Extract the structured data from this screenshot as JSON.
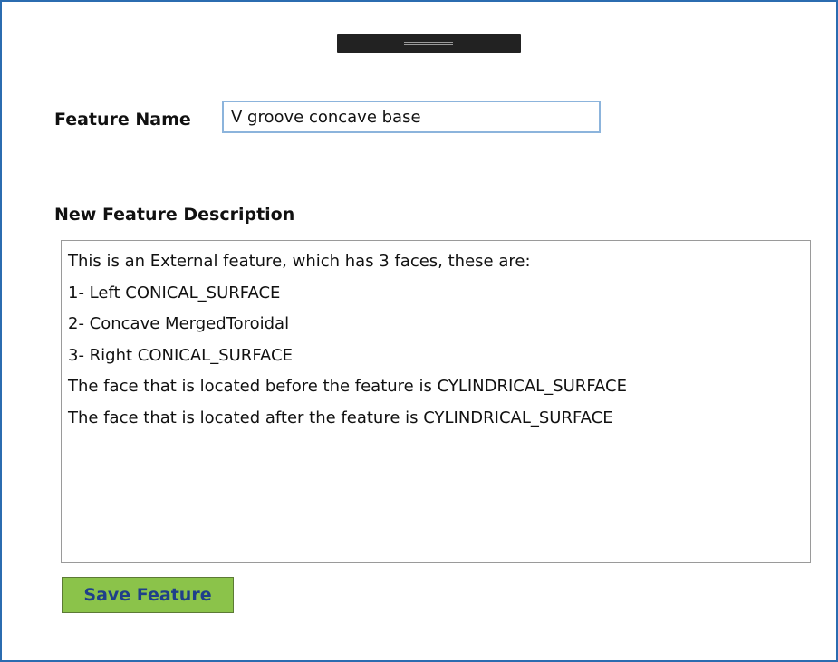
{
  "form": {
    "feature_name_label": "Feature Name",
    "feature_name_value": "V groove concave base",
    "description_label": "New Feature Description",
    "description_lines": [
      "This is an External feature, which has 3 faces, these are:",
      "1- Left CONICAL_SURFACE",
      "2- Concave MergedToroidal",
      "3- Right CONICAL_SURFACE",
      "The face that is located before the feature is CYLINDRICAL_SURFACE",
      "The face that is located after the feature is CYLINDRICAL_SURFACE"
    ],
    "save_label": "Save Feature"
  },
  "colors": {
    "window_border": "#2b6cb0",
    "save_button_bg": "#8bc34a",
    "save_button_text": "#1f3f8a",
    "input_border": "#8cb4dc",
    "drag_handle": "#222222"
  }
}
